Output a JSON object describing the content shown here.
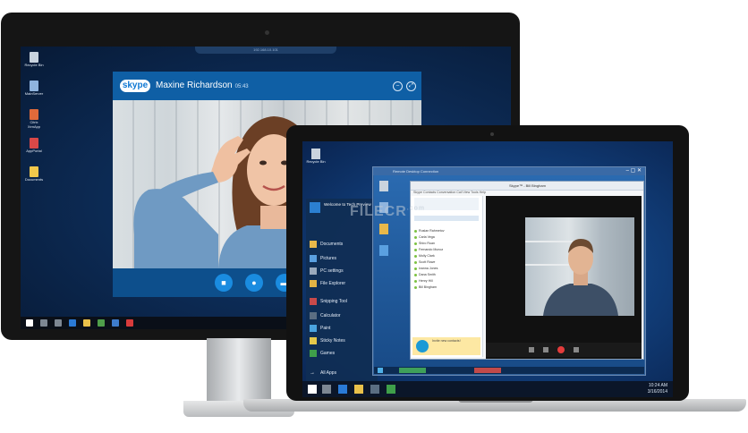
{
  "desktop_icons": [
    {
      "label": "Recycle Bin",
      "color": "#c9d3de"
    },
    {
      "label": "MainServer",
      "color": "#8fb4de"
    },
    {
      "label": "Citrix XenApp",
      "color": "#e06a3a"
    },
    {
      "label": "AppPortal",
      "color": "#d94848"
    },
    {
      "label": "Documents",
      "color": "#f1c84b"
    }
  ],
  "remote_bar_text": "192.168.10.101",
  "skype": {
    "logo": "skype",
    "contact_name": "Maxine Richardson",
    "call_time": "05:43",
    "accent": "#0f78d4"
  },
  "laptop": {
    "desktop_icon": "Recycle Bin",
    "user_name": "Welcome to Tech Preview",
    "start_items": [
      {
        "label": "Documents",
        "color": "#e8b84a"
      },
      {
        "label": "Pictures",
        "color": "#5aa0e0"
      },
      {
        "label": "PC settings",
        "color": "#9aa9bb"
      },
      {
        "label": "File Explorer",
        "color": "#e2b445"
      },
      {
        "label": "Snipping Tool",
        "color": "#c84a4a"
      },
      {
        "label": "Calculator",
        "color": "#5b6e82"
      },
      {
        "label": "Paint",
        "color": "#4aa4e0"
      },
      {
        "label": "Sticky Notes",
        "color": "#e4c84a"
      },
      {
        "label": "Games",
        "color": "#3f9f4a"
      }
    ],
    "all_apps": "All Apps",
    "rd_title": "Remote Desktop Connection",
    "skype_window_title": "Skype™ - Bill Bingham",
    "skype_menu": "Skype   Contacts   Conversation   Call   View   Tools   Help",
    "contacts": [
      "Ruslan Rahmetov",
      "Carla Vega",
      "Shiro Ruan",
      "Fernando Munoz",
      "Molly Clark",
      "Scott Rowe",
      "Ivanna Jones",
      "Dana Smith",
      "Henry Hill",
      "Bill Bingham"
    ],
    "notify_text": "Invite new contacts!",
    "watermark": "FILECR",
    "watermark_sub": ".com",
    "clock_time": "10:24 AM",
    "clock_date": "3/16/2014"
  }
}
